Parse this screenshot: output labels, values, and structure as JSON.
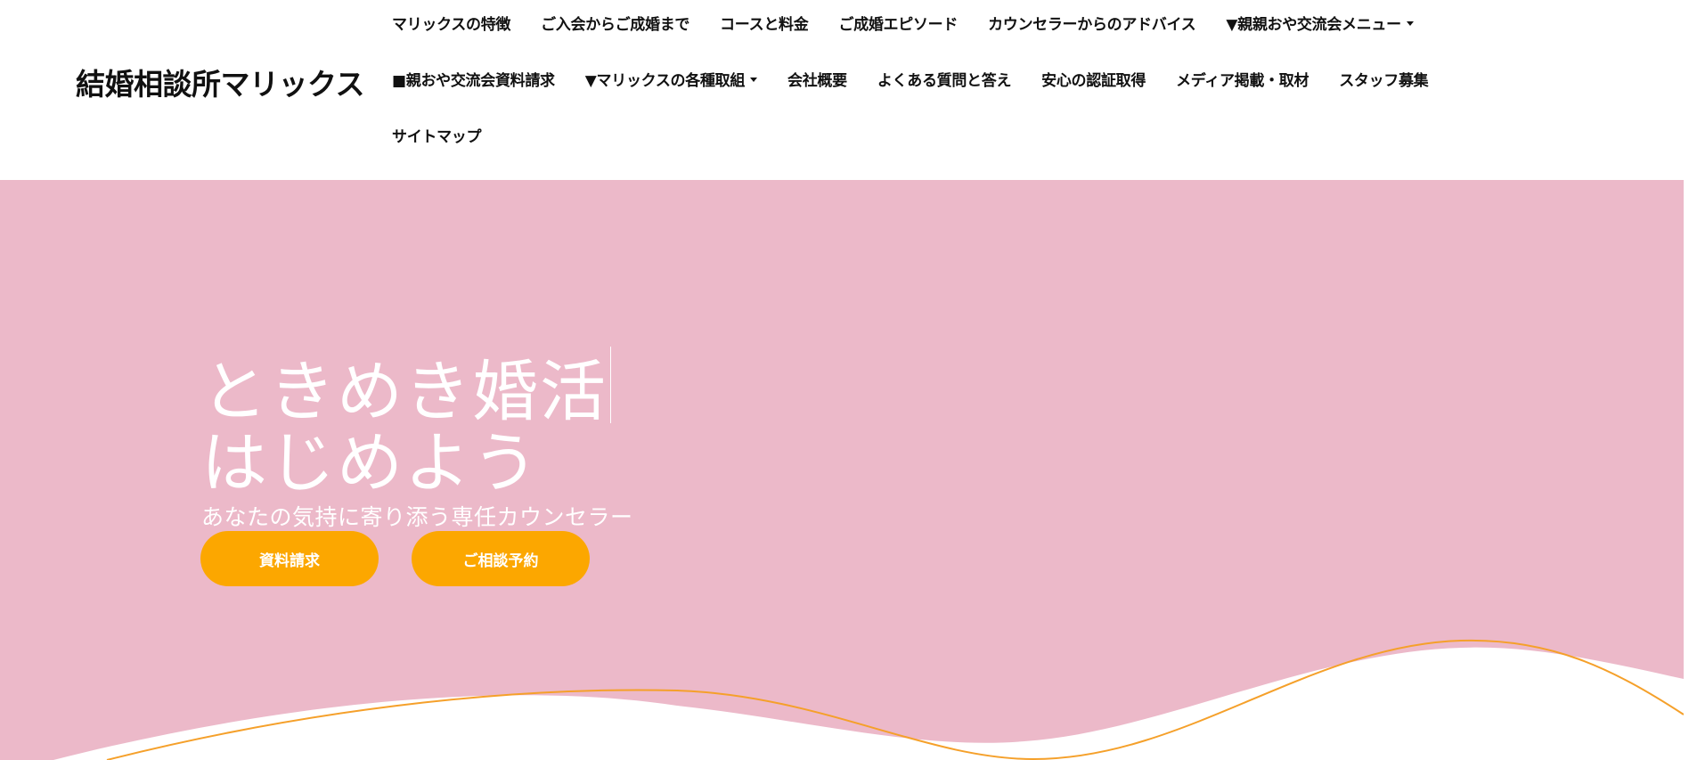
{
  "header": {
    "logo": "結婚相談所マリックス"
  },
  "nav": {
    "row1": [
      {
        "label": "マリックスの特徴"
      },
      {
        "label": "ご入会からご成婚まで"
      },
      {
        "label": "コースと料金"
      },
      {
        "label": "ご成婚エピソード"
      },
      {
        "label": "カウンセラーからのアドバイス"
      },
      {
        "label": "▼親親おや交流会メニュー",
        "dropdown": true
      }
    ],
    "row2": [
      {
        "label": "■親おや交流会資料請求"
      },
      {
        "label": "▼マリックスの各種取組",
        "dropdown": true
      },
      {
        "label": "会社概要"
      },
      {
        "label": "よくある質問と答え"
      },
      {
        "label": "安心の認証取得"
      },
      {
        "label": "メディア掲載・取材"
      },
      {
        "label": "スタッフ募集"
      }
    ],
    "row3": [
      {
        "label": "サイトマップ"
      }
    ]
  },
  "hero": {
    "title_line1": "ときめき婚活",
    "title_line2": "はじめよう",
    "subtitle": "あなたの気持に寄り添う専任カウンセラー",
    "button_request": "資料請求",
    "button_consult": "ご相談予約"
  },
  "colors": {
    "hero_background": "#ecb9c9",
    "button_accent": "#fca700",
    "wave_line": "#f5a02a",
    "text_dark": "#111111"
  },
  "icons": {
    "dropdown": "caret-down-icon"
  }
}
